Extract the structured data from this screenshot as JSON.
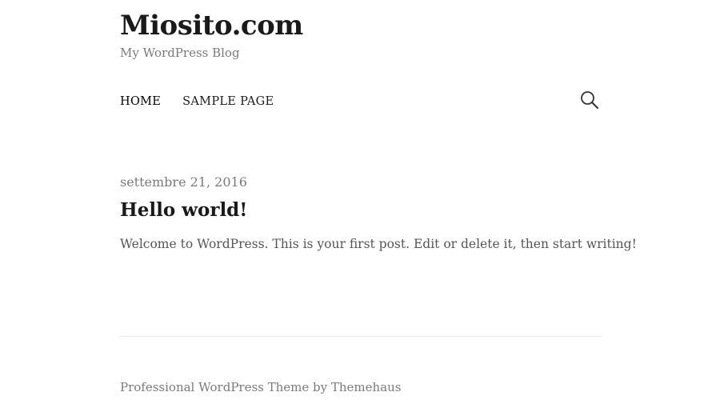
{
  "header": {
    "site_title": "Miosito.com",
    "tagline": "My WordPress Blog"
  },
  "nav": {
    "items": [
      {
        "label": "HOME",
        "active": true
      },
      {
        "label": "SAMPLE PAGE",
        "active": false
      }
    ],
    "search_icon": "search-icon"
  },
  "post": {
    "date": "settembre 21, 2016",
    "title": "Hello world!",
    "excerpt": "Welcome to WordPress. This is your first post. Edit or delete it, then start writing!"
  },
  "footer": {
    "credit": "Professional WordPress Theme by Themehaus"
  },
  "colors": {
    "text": "#1a1a1a",
    "muted": "#7a7a7a",
    "body_text": "#555555",
    "background": "#ffffff",
    "divider": "#e8e8e8"
  }
}
